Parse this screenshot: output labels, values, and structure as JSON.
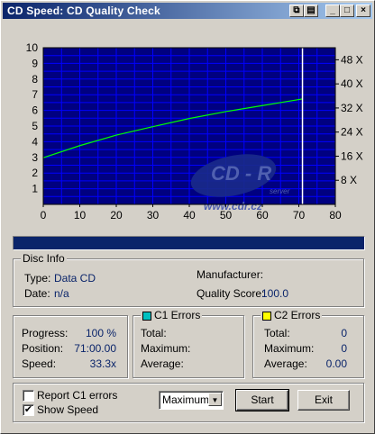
{
  "window": {
    "title": "CD Speed: CD Quality Check",
    "buttons": {
      "icon1": "⧉",
      "icon2": "💾",
      "minimize": "_",
      "maximize": "□",
      "close": "×"
    }
  },
  "chart_data": {
    "type": "line",
    "x_ticks": [
      "0",
      "10",
      "20",
      "30",
      "40",
      "50",
      "60",
      "70",
      "80"
    ],
    "y_ticks_left": [
      "10",
      "9",
      "8",
      "7",
      "6",
      "5",
      "4",
      "3",
      "2",
      "1"
    ],
    "y_ticks_right": [
      "48 X",
      "40 X",
      "32 X",
      "24 X",
      "16 X",
      "8 X"
    ],
    "xlim": [
      0,
      80
    ],
    "ylim_left": [
      0,
      10
    ],
    "ylim_right": [
      0,
      52
    ],
    "grid": true,
    "series": [
      {
        "color": "#00ff00",
        "axis": "right",
        "x": [
          0,
          10,
          20,
          30,
          40,
          50,
          60,
          70,
          71
        ],
        "y": [
          15.5,
          19.5,
          23,
          25.8,
          28.5,
          30.8,
          32.8,
          34.8,
          35.0
        ]
      }
    ],
    "marker_x": 71,
    "watermark": {
      "line1": "CD - R",
      "line2": "server",
      "url": "www.cdr.cz"
    },
    "colors": {
      "background": "#000080",
      "grid": "#0000ff",
      "line": "#00ff00",
      "marker": "#ffffff",
      "axis_text": "#000000"
    }
  },
  "progress_bar": {
    "percent": 100,
    "color": "#0a246a"
  },
  "disc_info": {
    "legend": "Disc Info",
    "type_label": "Type:",
    "type_value": "Data CD",
    "date_label": "Date:",
    "date_value": "n/a",
    "manufacturer_label": "Manufacturer:",
    "manufacturer_value": "",
    "quality_label": "Quality Score:",
    "quality_value": "100.0"
  },
  "progress_group": {
    "progress_label": "Progress:",
    "progress_value": "100 %",
    "position_label": "Position:",
    "position_value": "71:00.00",
    "speed_label": "Speed:",
    "speed_value": "33.3x"
  },
  "c1": {
    "legend": "C1 Errors",
    "color": "#00c0c0",
    "total_label": "Total:",
    "total_value": "",
    "max_label": "Maximum:",
    "max_value": "",
    "avg_label": "Average:",
    "avg_value": ""
  },
  "c2": {
    "legend": "C2 Errors",
    "color": "#ffff00",
    "total_label": "Total:",
    "total_value": "0",
    "max_label": "Maximum:",
    "max_value": "0",
    "avg_label": "Average:",
    "avg_value": "0.00"
  },
  "options": {
    "report_c1_label": "Report C1 errors",
    "report_c1_checked": false,
    "show_speed_label": "Show Speed",
    "show_speed_checked": true,
    "mode_value": "Maximum",
    "start_label": "Start",
    "exit_label": "Exit"
  }
}
